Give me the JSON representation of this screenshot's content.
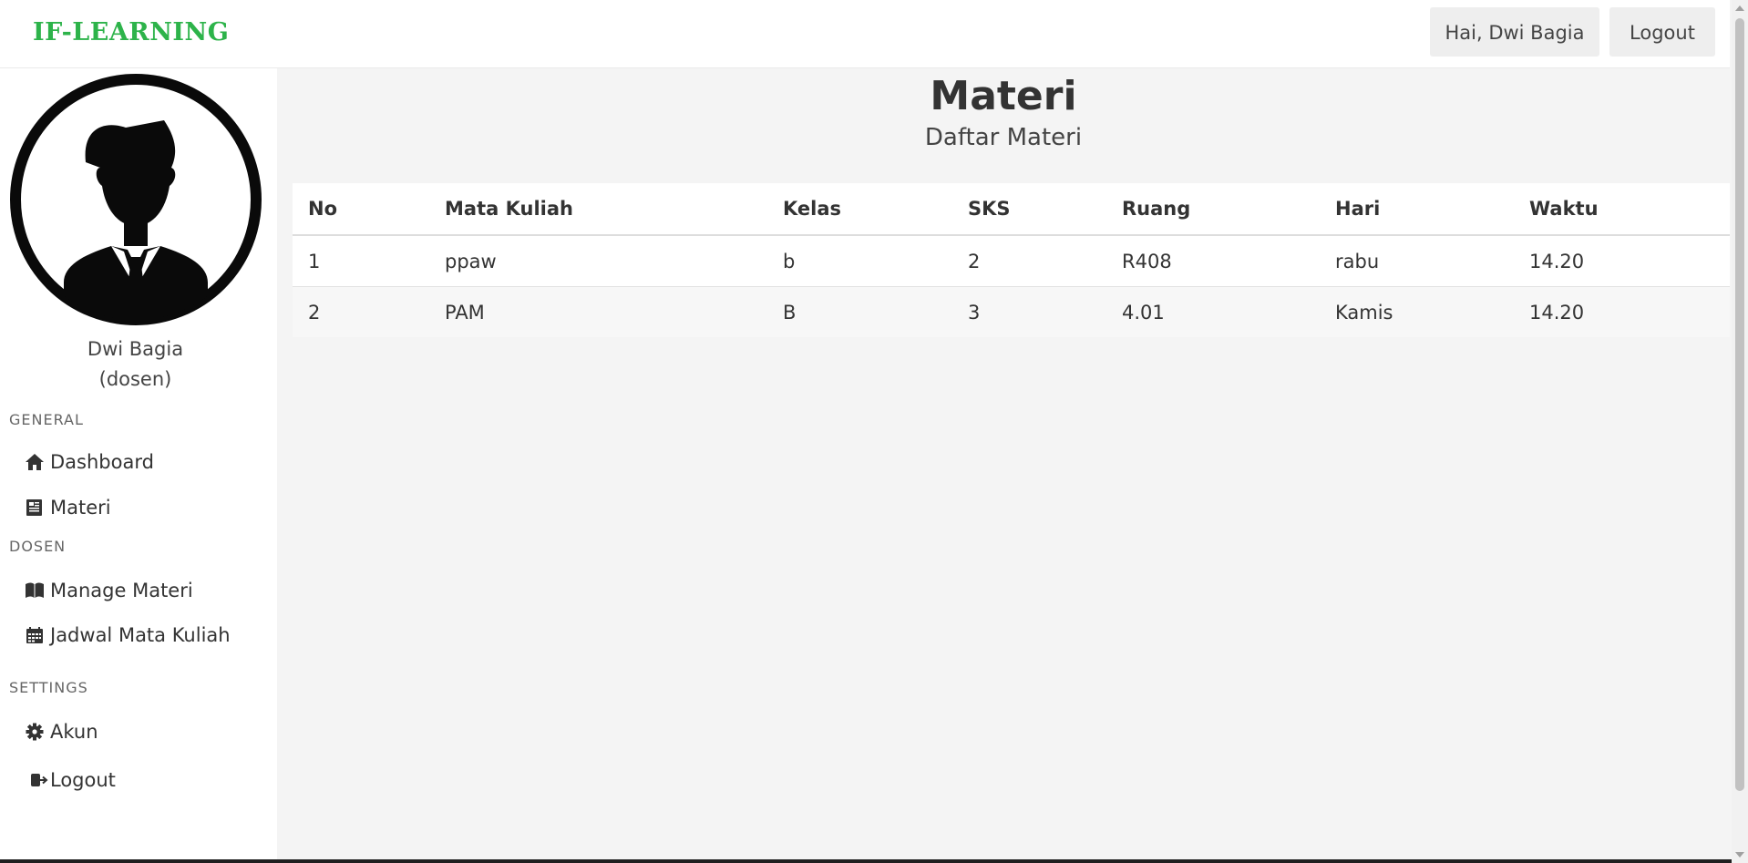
{
  "header": {
    "brand": "IF-LEARNING",
    "greeting_button": "Hai, Dwi Bagia",
    "logout_button": "Logout"
  },
  "profile": {
    "name": "Dwi Bagia",
    "role": "(dosen)"
  },
  "sidebar": {
    "sections": [
      {
        "label": "GENERAL",
        "items": [
          {
            "label": "Dashboard",
            "icon": "home-icon"
          },
          {
            "label": "Materi",
            "icon": "newspaper-icon"
          }
        ]
      },
      {
        "label": "DOSEN",
        "items": [
          {
            "label": "Manage Materi",
            "icon": "book-icon"
          },
          {
            "label": "Jadwal Mata Kuliah",
            "icon": "calendar-icon"
          }
        ]
      },
      {
        "label": "SETTINGS",
        "items": [
          {
            "label": "Akun",
            "icon": "gear-icon"
          },
          {
            "label": "Logout",
            "icon": "sign-out-icon"
          }
        ]
      }
    ]
  },
  "main": {
    "title": "Materi",
    "subtitle": "Daftar Materi",
    "table": {
      "headers": [
        "No",
        "Mata Kuliah",
        "Kelas",
        "SKS",
        "Ruang",
        "Hari",
        "Waktu"
      ],
      "rows": [
        [
          "1",
          "ppaw",
          "b",
          "2",
          "R408",
          "rabu",
          "14.20"
        ],
        [
          "2",
          "PAM",
          "B",
          "3",
          "4.01",
          "Kamis",
          "14.20"
        ]
      ]
    }
  },
  "colors": {
    "brand": "#2db34a",
    "background": "#f4f4f4",
    "sidebar": "#ffffff"
  }
}
